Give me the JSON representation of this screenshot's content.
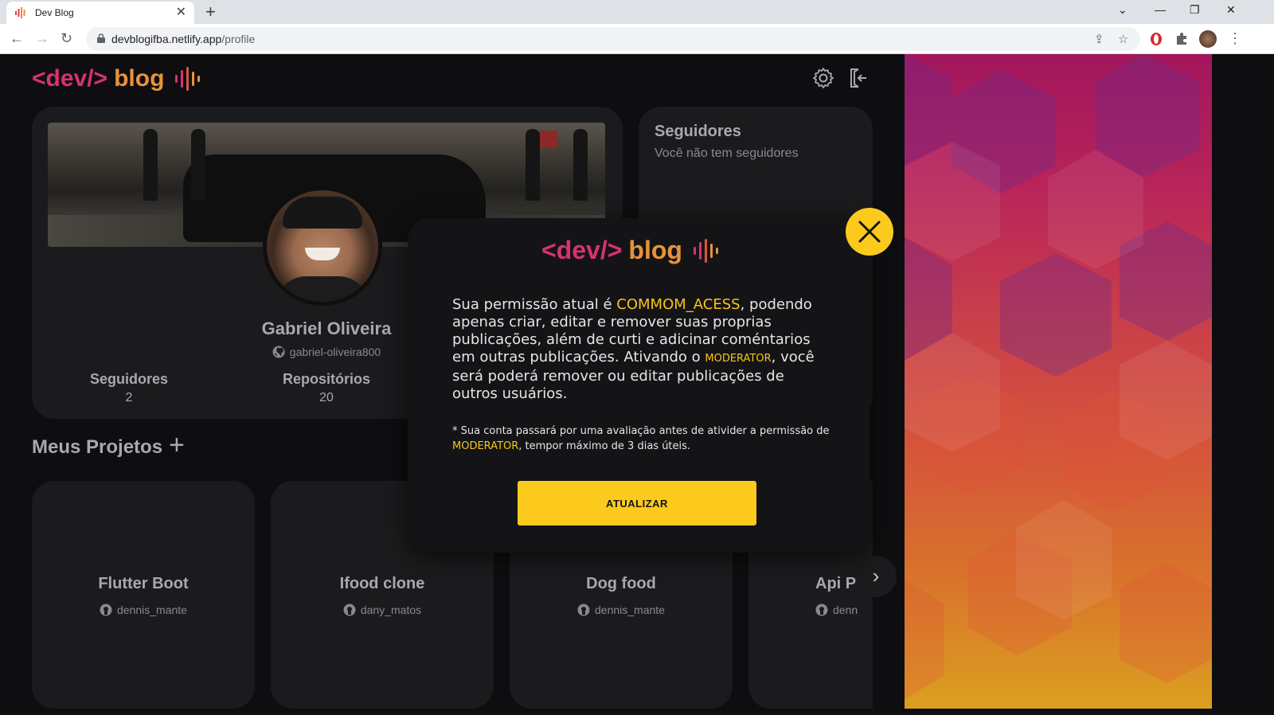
{
  "browser": {
    "tab_title": "Dev Blog",
    "url_domain": "devblogifba.netlify.app",
    "url_path": "/profile"
  },
  "header": {
    "logo_code": "<dev/>",
    "logo_word": "blog"
  },
  "profile": {
    "name": "Gabriel Oliveira",
    "github_user": "gabriel-oliveira800",
    "stats": [
      {
        "label": "Seguidores",
        "value": "2"
      },
      {
        "label": "Repositórios",
        "value": "20"
      }
    ]
  },
  "followers": {
    "title": "Seguidores",
    "empty_text": "Você não tem seguidores"
  },
  "projects": {
    "title": "Meus Projetos",
    "items": [
      {
        "name": "Flutter Boot",
        "owner": "dennis_mante"
      },
      {
        "name": "Ifood clone",
        "owner": "dany_matos"
      },
      {
        "name": "Dog food",
        "owner": "dennis_mante"
      },
      {
        "name": "Api P",
        "owner": "denn"
      }
    ]
  },
  "modal": {
    "logo_code": "<dev/>",
    "logo_word": "blog",
    "text_1": "Sua permissão atual é ",
    "current_permission": "COMMOM_ACESS",
    "text_2": ", podendo apenas criar, editar e remover suas proprias publicações, além de curti e adicinar coméntarios em outras publicações. Ativando o ",
    "target_permission": "MODERATOR",
    "text_3": ", você será poderá remover ou editar publicações de outros usuários.",
    "note_1": "* Sua conta passará por uma avaliação antes de ativider a permissão de ",
    "note_permission": "MODERATOR",
    "note_2": ", tempor máximo de 3 dias úteis.",
    "button_label": "ATUALIZAR"
  },
  "colors": {
    "accent_yellow": "#fcca1d",
    "logo_pink": "#d63370",
    "logo_orange": "#e8923a",
    "card_bg": "#1b1b1d",
    "page_bg": "#0e0e10"
  }
}
